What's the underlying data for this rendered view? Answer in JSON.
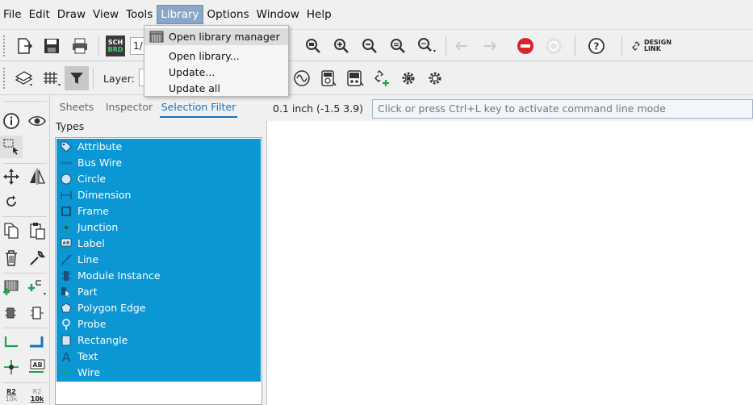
{
  "menubar": {
    "items": [
      {
        "label": "File"
      },
      {
        "label": "Edit"
      },
      {
        "label": "Draw"
      },
      {
        "label": "View"
      },
      {
        "label": "Tools"
      },
      {
        "label": "Library",
        "active": true
      },
      {
        "label": "Options"
      },
      {
        "label": "Window"
      },
      {
        "label": "Help"
      }
    ]
  },
  "library_menu": {
    "items": [
      {
        "label": "Open library manager"
      },
      {
        "label": "Open library..."
      },
      {
        "label": "Update..."
      },
      {
        "label": "Update all"
      }
    ]
  },
  "toolbar": {
    "sheet_combo_value": "1/",
    "design_link_line1": "DESIGN",
    "design_link_line2": "LINK",
    "sch_brd_line1": "SCH",
    "sch_brd_line2": "BRD",
    "layer_label": "Layer:"
  },
  "panel": {
    "tabs": [
      {
        "label": "Sheets"
      },
      {
        "label": "Inspector"
      },
      {
        "label": "Selection Filter",
        "active": true
      }
    ],
    "types_label": "Types",
    "types": [
      {
        "label": "Attribute",
        "icon": "tag-icon"
      },
      {
        "label": "Bus Wire",
        "icon": "bus-wire-icon"
      },
      {
        "label": "Circle",
        "icon": "circle-icon"
      },
      {
        "label": "Dimension",
        "icon": "dimension-icon"
      },
      {
        "label": "Frame",
        "icon": "frame-icon"
      },
      {
        "label": "Junction",
        "icon": "junction-icon"
      },
      {
        "label": "Label",
        "icon": "label-icon"
      },
      {
        "label": "Line",
        "icon": "line-icon"
      },
      {
        "label": "Module Instance",
        "icon": "module-instance-icon"
      },
      {
        "label": "Part",
        "icon": "part-icon"
      },
      {
        "label": "Polygon Edge",
        "icon": "polygon-icon"
      },
      {
        "label": "Probe",
        "icon": "probe-icon"
      },
      {
        "label": "Rectangle",
        "icon": "rectangle-icon"
      },
      {
        "label": "Text",
        "icon": "text-icon"
      },
      {
        "label": "Wire",
        "icon": "wire-icon"
      }
    ]
  },
  "leftcol": {
    "r2_label": "R2",
    "value_label": "10k"
  },
  "status": {
    "coords": "0.1 inch (-1.5 3.9)",
    "cmd_placeholder": "Click or press Ctrl+L key to activate command line mode"
  },
  "colors": {
    "selection": "#0b96d4",
    "accent_tab": "#1a73b8",
    "menu_active": "#8aa7c7",
    "green_tool": "#1aa34a",
    "blue_tool": "#1a73b8",
    "stop_red": "#d9232d"
  }
}
